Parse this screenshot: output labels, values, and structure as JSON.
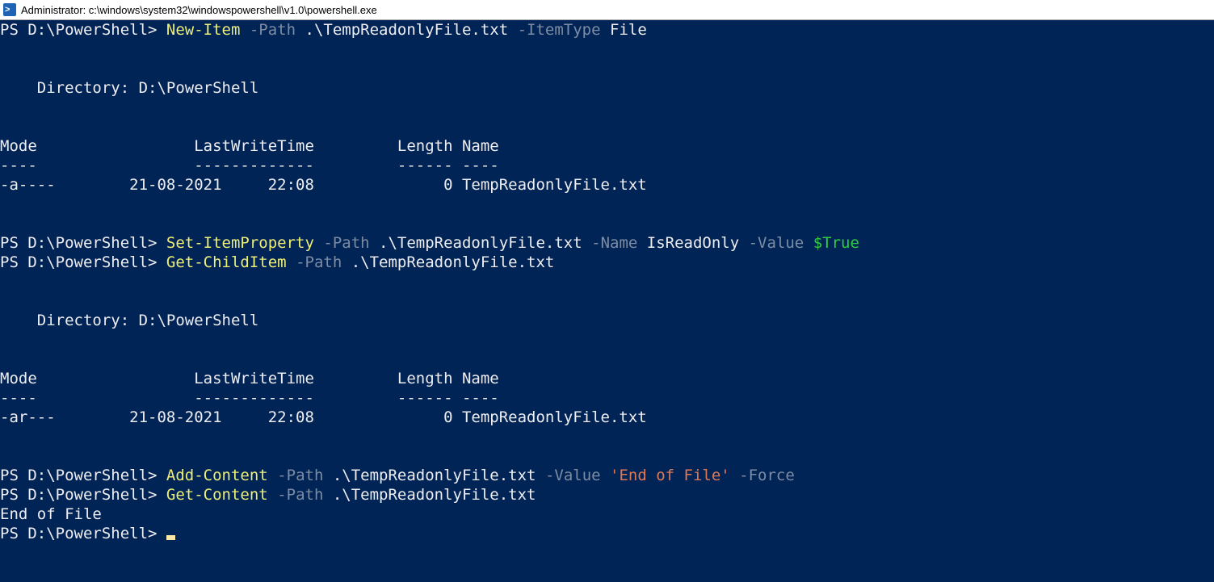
{
  "window": {
    "title": "Administrator: c:\\windows\\system32\\windowspowershell\\v1.0\\powershell.exe"
  },
  "lines": {
    "l1_prompt": "PS D:\\PowerShell> ",
    "l1_cmd": "New-Item",
    "l1_p1": " -Path",
    "l1_a1": " .\\TempReadonlyFile.txt",
    "l1_p2": " -ItemType",
    "l1_a2": " File",
    "dir1": "    Directory: D:\\PowerShell",
    "hdr1": "Mode                 LastWriteTime         Length Name",
    "sep1": "----                 -------------         ------ ----",
    "row1": "-a----        21-08-2021     22:08              0 TempReadonlyFile.txt",
    "l2_prompt": "PS D:\\PowerShell> ",
    "l2_cmd": "Set-ItemProperty",
    "l2_p1": " -Path",
    "l2_a1": " .\\TempReadonlyFile.txt",
    "l2_p2": " -Name",
    "l2_a2": " IsReadOnly",
    "l2_p3": " -Value",
    "l2_a3": " $True",
    "l3_prompt": "PS D:\\PowerShell> ",
    "l3_cmd": "Get-ChildItem",
    "l3_p1": " -Path",
    "l3_a1": " .\\TempReadonlyFile.txt",
    "dir2": "    Directory: D:\\PowerShell",
    "hdr2": "Mode                 LastWriteTime         Length Name",
    "sep2": "----                 -------------         ------ ----",
    "row2": "-ar---        21-08-2021     22:08              0 TempReadonlyFile.txt",
    "l4_prompt": "PS D:\\PowerShell> ",
    "l4_cmd": "Add-Content",
    "l4_p1": " -Path",
    "l4_a1": " .\\TempReadonlyFile.txt",
    "l4_p2": " -Value",
    "l4_a2": " 'End of File'",
    "l4_p3": " -Force",
    "l5_prompt": "PS D:\\PowerShell> ",
    "l5_cmd": "Get-Content",
    "l5_p1": " -Path",
    "l5_a1": " .\\TempReadonlyFile.txt",
    "out1": "End of File",
    "l6_prompt": "PS D:\\PowerShell> "
  }
}
